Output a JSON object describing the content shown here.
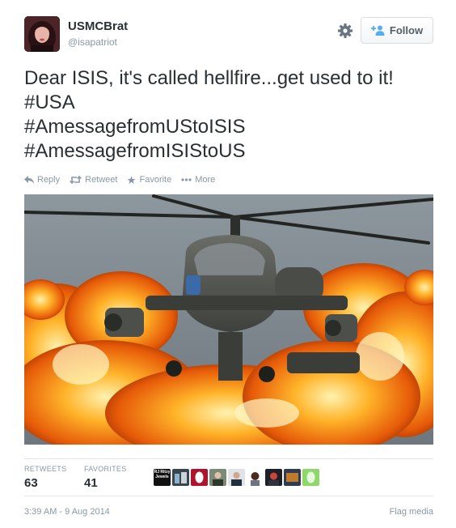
{
  "user": {
    "display_name": "USMCBrat",
    "handle": "@isapatriot"
  },
  "follow_button": {
    "label": "Follow"
  },
  "tweet": {
    "text_line1": "Dear ISIS, it's called hellfire...get used to it!",
    "hashtags": [
      "#USA",
      "#AmessagefromUStoISIS",
      "#AmessagefromISIStoUS"
    ]
  },
  "actions": {
    "reply": "Reply",
    "retweet": "Retweet",
    "favorite": "Favorite",
    "more": "More"
  },
  "stats": {
    "retweets_label": "RETWEETS",
    "retweets_value": "63",
    "favorites_label": "FAVORITES",
    "favorites_value": "41"
  },
  "favoriters": {
    "first_avatar_text": "RJ Ritzy Jewels"
  },
  "footer": {
    "timestamp": "3:39 AM - 9 Aug 2014",
    "flag_media": "Flag media"
  },
  "colors": {
    "text": "#292f33",
    "muted": "#8899a6",
    "follow_icon": "#55acee"
  },
  "icons": {
    "settings": "gear-icon",
    "follow": "add-user-icon",
    "reply": "reply-icon",
    "retweet": "retweet-icon",
    "favorite": "star-icon",
    "more": "ellipsis-icon"
  }
}
